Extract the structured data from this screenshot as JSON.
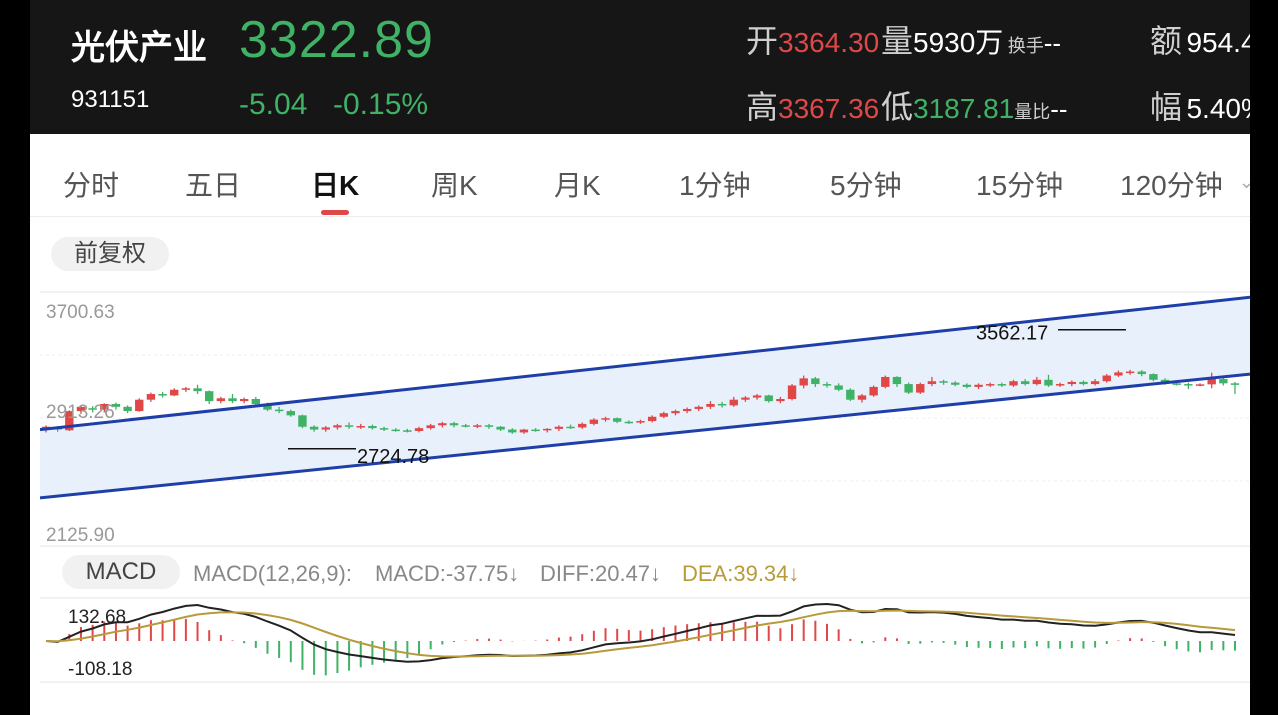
{
  "header": {
    "name": "光伏产业",
    "code": "931151",
    "price": "3322.89",
    "change": "-5.04",
    "change_pct": "-0.15%",
    "open_label": "开",
    "open": "3364.30",
    "volume_label": "量",
    "volume": "5930万",
    "turnover_label": "换手",
    "turnover": "--",
    "amount_label": "额",
    "amount": "954.4",
    "high_label": "高",
    "high": "3367.36",
    "low_label": "低",
    "low": "3187.81",
    "vol_ratio_label": "量比",
    "vol_ratio": "--",
    "amplitude_label": "幅",
    "amplitude": "5.40%"
  },
  "tabs": [
    {
      "label": "分时"
    },
    {
      "label": "五日"
    },
    {
      "label": "日K",
      "active": true
    },
    {
      "label": "周K"
    },
    {
      "label": "月K"
    },
    {
      "label": "1分钟"
    },
    {
      "label": "5分钟"
    },
    {
      "label": "15分钟"
    },
    {
      "label": "120分钟"
    }
  ],
  "tab_more_icon": "chevron-down-icon",
  "adjust_label": "前复权",
  "colors": {
    "up": "#e04848",
    "down": "#3fb266",
    "channel": "#1f3fa8",
    "dif": "#222222",
    "dea": "#b89a3a"
  },
  "chart_data": {
    "type": "candlestick",
    "y_labels": [
      "3700.63",
      "2913.26",
      "2125.90"
    ],
    "ylim": [
      2125.9,
      3700.63
    ],
    "annotations": [
      {
        "label": "2724.78",
        "value": 2724.78
      },
      {
        "label": "3562.17",
        "value": 3562.17
      }
    ],
    "candles": [
      [
        2870,
        2880,
        2850,
        2840,
        2890
      ],
      [
        2875,
        2860,
        2850,
        2845,
        2885
      ],
      [
        2855,
        2990,
        2855,
        2850,
        2995
      ],
      [
        2990,
        3020,
        2980,
        2970,
        3030
      ],
      [
        3010,
        3000,
        2990,
        2980,
        3025
      ],
      [
        3000,
        3040,
        2985,
        2980,
        3045
      ],
      [
        3040,
        3020,
        3005,
        3000,
        3050
      ],
      [
        3020,
        2990,
        2990,
        2975,
        3030
      ],
      [
        2990,
        3070,
        2985,
        2985,
        3080
      ],
      [
        3070,
        3110,
        3060,
        3055,
        3120
      ],
      [
        3110,
        3100,
        3090,
        3085,
        3125
      ],
      [
        3100,
        3140,
        3095,
        3095,
        3150
      ],
      [
        3140,
        3150,
        3130,
        3125,
        3160
      ],
      [
        3150,
        3130,
        3120,
        3110,
        3175
      ],
      [
        3130,
        3060,
        3055,
        3040,
        3135
      ],
      [
        3060,
        3080,
        3050,
        3045,
        3090
      ],
      [
        3080,
        3060,
        3050,
        3045,
        3110
      ],
      [
        3060,
        3075,
        3050,
        3045,
        3085
      ],
      [
        3075,
        3040,
        3035,
        3030,
        3090
      ],
      [
        3040,
        3000,
        2995,
        2990,
        3050
      ],
      [
        3000,
        2990,
        2980,
        2975,
        3020
      ],
      [
        2990,
        2960,
        2955,
        2950,
        3000
      ],
      [
        2960,
        2880,
        2875,
        2870,
        2965
      ],
      [
        2880,
        2860,
        2850,
        2845,
        2890
      ],
      [
        2860,
        2875,
        2850,
        2845,
        2885
      ],
      [
        2875,
        2890,
        2865,
        2860,
        2900
      ],
      [
        2890,
        2880,
        2870,
        2865,
        2910
      ],
      [
        2880,
        2885,
        2870,
        2865,
        2900
      ],
      [
        2885,
        2870,
        2865,
        2860,
        2895
      ],
      [
        2870,
        2860,
        2855,
        2850,
        2880
      ],
      [
        2860,
        2855,
        2850,
        2845,
        2870
      ],
      [
        2855,
        2850,
        2845,
        2840,
        2865
      ],
      [
        2850,
        2870,
        2845,
        2840,
        2880
      ],
      [
        2870,
        2890,
        2865,
        2860,
        2900
      ],
      [
        2890,
        2905,
        2880,
        2875,
        2915
      ],
      [
        2905,
        2890,
        2880,
        2875,
        2915
      ],
      [
        2890,
        2885,
        2880,
        2875,
        2900
      ],
      [
        2885,
        2890,
        2875,
        2870,
        2900
      ],
      [
        2890,
        2880,
        2870,
        2865,
        2900
      ],
      [
        2880,
        2860,
        2855,
        2850,
        2885
      ],
      [
        2860,
        2840,
        2835,
        2830,
        2870
      ],
      [
        2840,
        2860,
        2835,
        2830,
        2865
      ],
      [
        2860,
        2855,
        2850,
        2845,
        2870
      ],
      [
        2855,
        2865,
        2845,
        2840,
        2870
      ],
      [
        2865,
        2880,
        2855,
        2850,
        2890
      ],
      [
        2880,
        2875,
        2870,
        2865,
        2895
      ],
      [
        2875,
        2900,
        2870,
        2865,
        2910
      ],
      [
        2900,
        2930,
        2895,
        2890,
        2940
      ],
      [
        2930,
        2940,
        2920,
        2915,
        2950
      ],
      [
        2940,
        2915,
        2910,
        2905,
        2945
      ],
      [
        2915,
        2910,
        2905,
        2900,
        2925
      ],
      [
        2910,
        2920,
        2905,
        2900,
        2930
      ],
      [
        2920,
        2950,
        2915,
        2910,
        2960
      ],
      [
        2950,
        2975,
        2945,
        2940,
        2985
      ],
      [
        2975,
        2990,
        2965,
        2960,
        3000
      ],
      [
        2990,
        3005,
        2980,
        2975,
        3015
      ],
      [
        3005,
        3020,
        2995,
        2990,
        3030
      ],
      [
        3020,
        3040,
        3010,
        3005,
        3060
      ],
      [
        3040,
        3030,
        3020,
        3015,
        3055
      ],
      [
        3030,
        3070,
        3025,
        3020,
        3090
      ],
      [
        3070,
        3085,
        3060,
        3055,
        3095
      ],
      [
        3085,
        3100,
        3075,
        3070,
        3110
      ],
      [
        3100,
        3060,
        3055,
        3050,
        3105
      ],
      [
        3060,
        3075,
        3050,
        3045,
        3090
      ],
      [
        3075,
        3170,
        3070,
        3065,
        3180
      ],
      [
        3170,
        3220,
        3160,
        3150,
        3240
      ],
      [
        3220,
        3180,
        3170,
        3160,
        3230
      ],
      [
        3180,
        3170,
        3160,
        3155,
        3195
      ],
      [
        3170,
        3140,
        3135,
        3130,
        3185
      ],
      [
        3140,
        3070,
        3065,
        3060,
        3150
      ],
      [
        3070,
        3100,
        3060,
        3050,
        3110
      ],
      [
        3100,
        3160,
        3095,
        3090,
        3170
      ],
      [
        3160,
        3230,
        3155,
        3150,
        3240
      ],
      [
        3230,
        3180,
        3170,
        3160,
        3235
      ],
      [
        3180,
        3120,
        3115,
        3110,
        3190
      ],
      [
        3120,
        3180,
        3115,
        3110,
        3190
      ],
      [
        3180,
        3200,
        3170,
        3165,
        3230
      ],
      [
        3200,
        3190,
        3180,
        3175,
        3210
      ],
      [
        3190,
        3175,
        3170,
        3165,
        3200
      ],
      [
        3175,
        3160,
        3155,
        3150,
        3185
      ],
      [
        3160,
        3175,
        3150,
        3145,
        3185
      ],
      [
        3175,
        3180,
        3165,
        3160,
        3190
      ],
      [
        3180,
        3170,
        3165,
        3160,
        3190
      ],
      [
        3170,
        3200,
        3165,
        3160,
        3210
      ],
      [
        3200,
        3180,
        3175,
        3170,
        3215
      ],
      [
        3180,
        3210,
        3175,
        3170,
        3230
      ],
      [
        3210,
        3170,
        3165,
        3160,
        3245
      ],
      [
        3170,
        3180,
        3165,
        3160,
        3190
      ],
      [
        3180,
        3195,
        3170,
        3165,
        3205
      ],
      [
        3195,
        3180,
        3175,
        3170,
        3205
      ],
      [
        3180,
        3200,
        3175,
        3170,
        3215
      ],
      [
        3200,
        3240,
        3195,
        3190,
        3250
      ],
      [
        3240,
        3262,
        3235,
        3230,
        3275
      ],
      [
        3262,
        3268,
        3250,
        3245,
        3280
      ],
      [
        3268,
        3250,
        3240,
        3235,
        3278
      ],
      [
        3250,
        3210,
        3205,
        3200,
        3255
      ],
      [
        3210,
        3185,
        3180,
        3175,
        3220
      ],
      [
        3185,
        3180,
        3175,
        3170,
        3195
      ],
      [
        3180,
        3175,
        3150,
        3145,
        3190
      ],
      [
        3175,
        3178,
        3168,
        3165,
        3185
      ],
      [
        3178,
        3215,
        3168,
        3150,
        3260
      ],
      [
        3215,
        3185,
        3180,
        3170,
        3230
      ],
      [
        3185,
        3180,
        3170,
        3110,
        3195
      ]
    ],
    "channel_upper": [
      [
        2860,
        3790
      ]
    ],
    "channel_lower": [
      [
        2380,
        3250
      ]
    ],
    "macd": {
      "labels": [
        "132.68",
        "-108.18"
      ],
      "name": "MACD",
      "params": "MACD(12,26,9):",
      "macd_text": "MACD:-37.75",
      "diff_text": "DIFF:20.47",
      "dea_text": "DEA:39.34",
      "ylim": [
        -150,
        150
      ]
    }
  }
}
